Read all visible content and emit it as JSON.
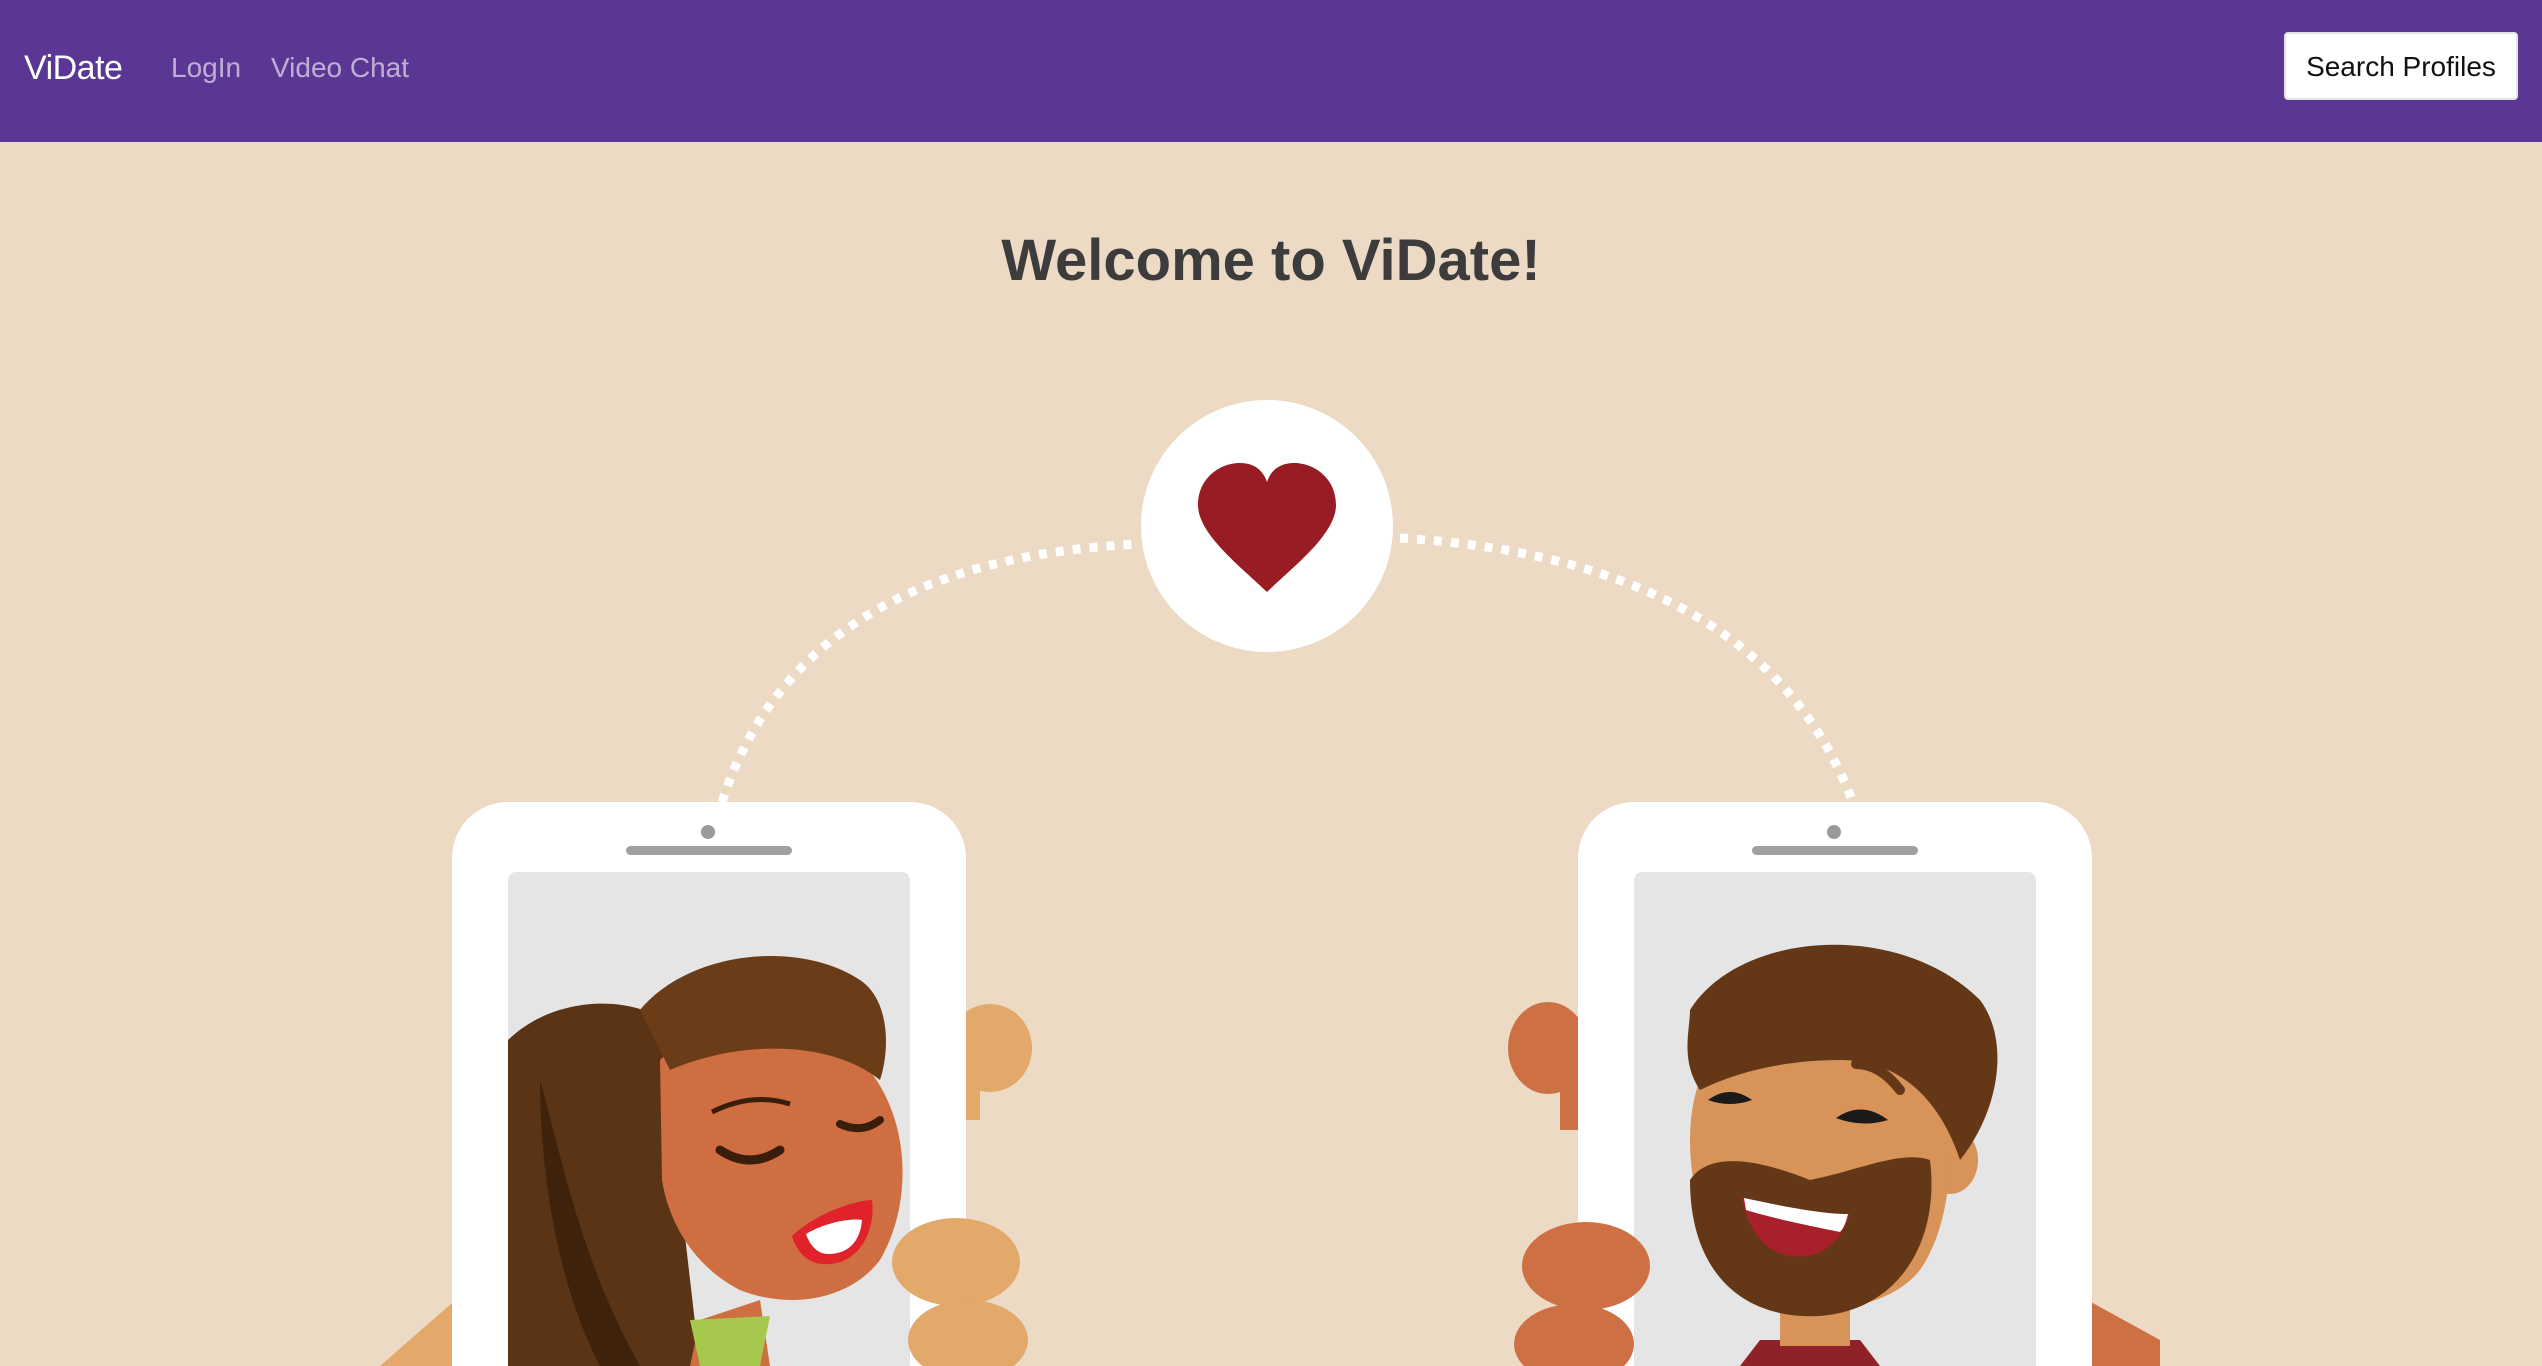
{
  "navbar": {
    "brand": "ViDate",
    "links": [
      "LogIn",
      "Video Chat"
    ],
    "search_button_label": "Search Profiles"
  },
  "main": {
    "title": "Welcome to ViDate!"
  },
  "illustration": {
    "center_icon": "heart-icon",
    "left_person": "woman-avatar",
    "right_person": "man-avatar"
  },
  "colors": {
    "navbar_bg": "#5a3795",
    "page_bg": "#ecdac4",
    "heart": "#971c24"
  }
}
